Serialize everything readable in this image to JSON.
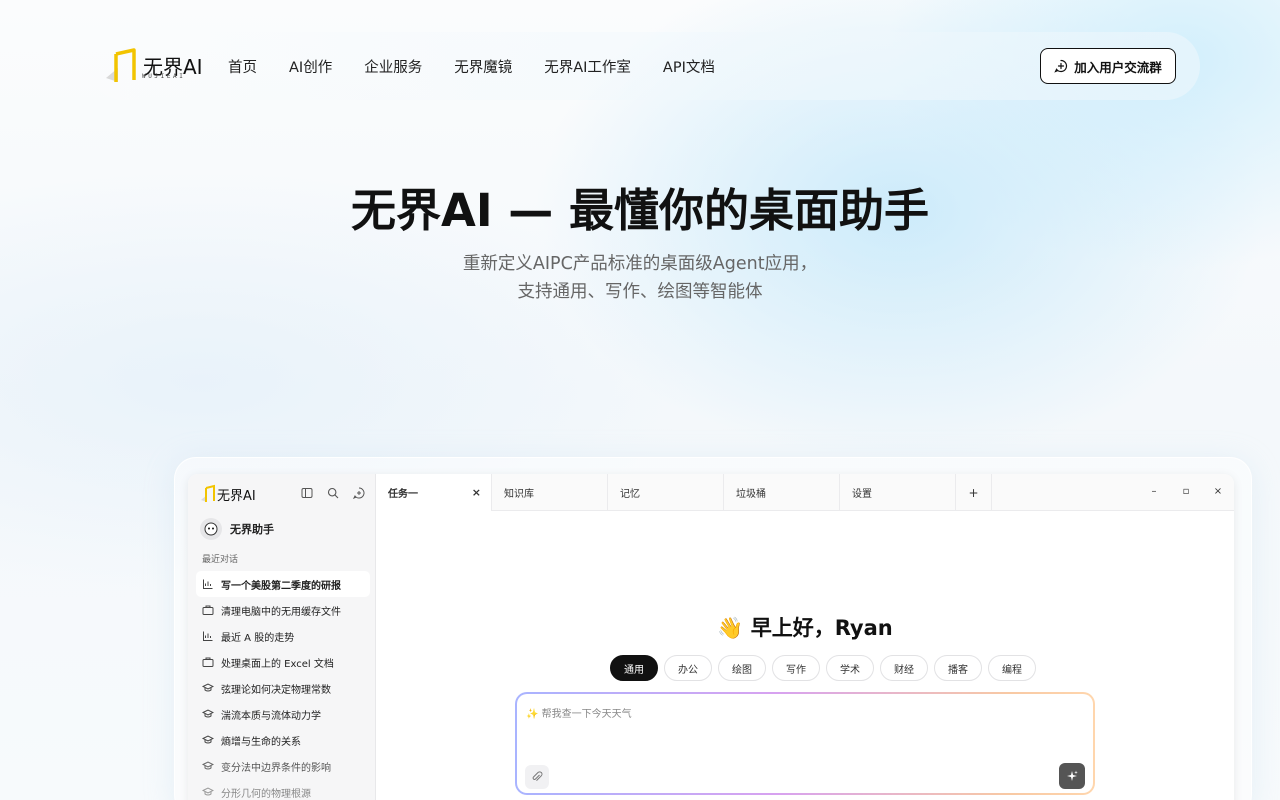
{
  "brand": {
    "name": "无界AI",
    "wordmark_sub": "WUJIEAI",
    "accent": "#f2c400"
  },
  "nav": {
    "links": [
      "首页",
      "AI创作",
      "企业服务",
      "无界魔镜",
      "无界AI工作室",
      "API文档"
    ],
    "join_button": "加入用户交流群"
  },
  "hero": {
    "title": "无界AI — 最懂你的桌面助手",
    "subtitle_line1": "重新定义AIPC产品标准的桌面级Agent应用，",
    "subtitle_line2": "支持通用、写作、绘图等智能体"
  },
  "app": {
    "sidebar": {
      "logo_text": "无界AI",
      "icons": [
        "sidebar-toggle-icon",
        "search-icon",
        "new-chat-icon"
      ],
      "assistant_name": "无界助手",
      "recent_label": "最近对话",
      "recent": [
        {
          "label": "写一个美股第二季度的研报",
          "icon": "chart-icon",
          "active": true
        },
        {
          "label": "清理电脑中的无用缓存文件",
          "icon": "briefcase-icon",
          "active": false
        },
        {
          "label": "最近 A 股的走势",
          "icon": "chart-icon",
          "active": false
        },
        {
          "label": "处理桌面上的 Excel 文档",
          "icon": "briefcase-icon",
          "active": false
        },
        {
          "label": "弦理论如何决定物理常数",
          "icon": "graduation-cap-icon",
          "active": false
        },
        {
          "label": "湍流本质与流体动力学",
          "icon": "graduation-cap-icon",
          "active": false
        },
        {
          "label": "熵增与生命的关系",
          "icon": "graduation-cap-icon",
          "active": false
        },
        {
          "label": "变分法中边界条件的影响",
          "icon": "graduation-cap-icon",
          "active": false
        },
        {
          "label": "分形几何的物理根源",
          "icon": "graduation-cap-icon",
          "active": false
        }
      ]
    },
    "tabs": [
      "任务一",
      "知识库",
      "记忆",
      "垃圾桶",
      "设置"
    ],
    "tab_close": "×",
    "tab_add": "+",
    "window_controls": [
      "–",
      "▫",
      "×"
    ],
    "greeting": "👋 早上好，Ryan",
    "chips": [
      "通用",
      "办公",
      "绘图",
      "写作",
      "学术",
      "财经",
      "播客",
      "编程"
    ],
    "active_chip": "通用",
    "input_placeholder": "✨ 帮我查一下今天天气"
  }
}
